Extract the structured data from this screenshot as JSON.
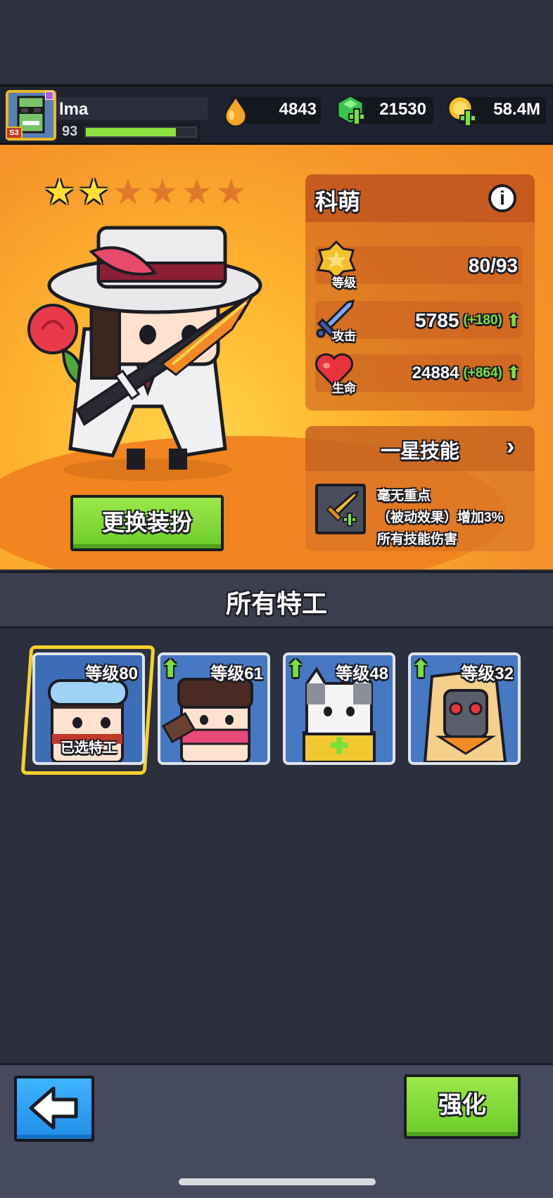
{
  "player": {
    "name": "lma",
    "level": "93",
    "season_badge": "S3",
    "xp_fraction": 0.82
  },
  "resources": [
    {
      "icon": "energy-drop-icon",
      "value": "4843",
      "has_plus": false
    },
    {
      "icon": "green-gem-icon",
      "value": "21530",
      "has_plus": true
    },
    {
      "icon": "gold-coin-icon",
      "value": "58.4M",
      "has_plus": true
    }
  ],
  "hero": {
    "stars_filled": 2,
    "stars_total": 6,
    "name": "科萌",
    "stats": [
      {
        "icon": "level-badge-icon",
        "label": "等级",
        "value": "80/93",
        "bonus": ""
      },
      {
        "icon": "sword-icon",
        "label": "攻击",
        "value": "5785",
        "bonus": "(+180)"
      },
      {
        "icon": "heart-icon",
        "label": "生命",
        "value": "24884",
        "bonus": "(+864)"
      }
    ],
    "skill": {
      "title": "一星技能",
      "name": "毫无重点",
      "line2": "（被动效果）增加3%",
      "line3": "所有技能伤害"
    },
    "change_outfit_label": "更换装扮"
  },
  "section_title": "所有特工",
  "agents": [
    {
      "level_label": "等级80",
      "selected": true,
      "selected_label": "已选特工",
      "upgrade_arrow": false,
      "portrait": "goggles-agent"
    },
    {
      "level_label": "等级61",
      "selected": false,
      "selected_label": "",
      "upgrade_arrow": true,
      "portrait": "ninja-girl-agent"
    },
    {
      "level_label": "等级48",
      "selected": false,
      "selected_label": "",
      "upgrade_arrow": true,
      "portrait": "cat-agent"
    },
    {
      "level_label": "等级32",
      "selected": false,
      "selected_label": "",
      "upgrade_arrow": true,
      "portrait": "masked-agent"
    }
  ],
  "bottom": {
    "upgrade_label": "强化"
  },
  "colors": {
    "accent_green": "#8ee03e",
    "hero_orange": "#f5952a",
    "back_blue": "#2a9df4",
    "selected_yellow": "#f5d22a"
  }
}
